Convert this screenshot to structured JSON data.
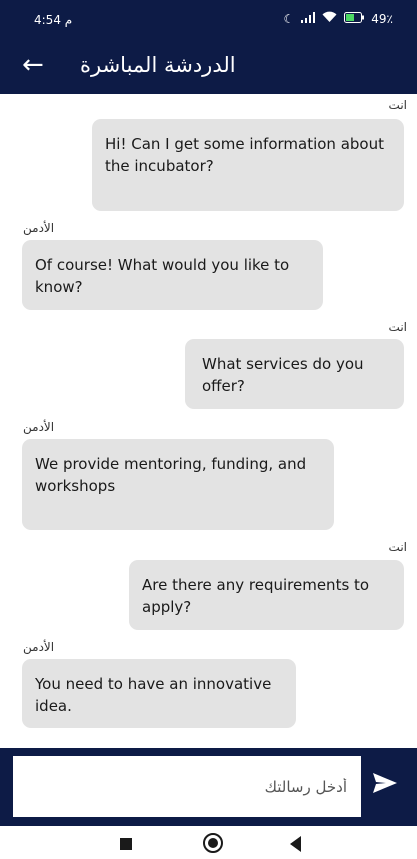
{
  "status_bar": {
    "time": "4:54 م",
    "battery": "49٪"
  },
  "header": {
    "title": "الدردشة المباشرة"
  },
  "messages": [
    {
      "sender": "انت",
      "text": "Hi! Can I get some information about the incubator?"
    },
    {
      "sender": "الأدمن",
      "text": "Of course! What would you like to know?"
    },
    {
      "sender": "انت",
      "text": "What services do you offer?"
    },
    {
      "sender": "الأدمن",
      "text": "We provide mentoring, funding, and workshops"
    },
    {
      "sender": "انت",
      "text": "Are there any requirements to apply?"
    },
    {
      "sender": "الأدمن",
      "text": "You need to have an innovative idea."
    }
  ],
  "composer": {
    "placeholder": "أدخل رسالتك"
  },
  "colors": {
    "primary": "#0d1b46",
    "bubble": "#e3e3e3"
  }
}
